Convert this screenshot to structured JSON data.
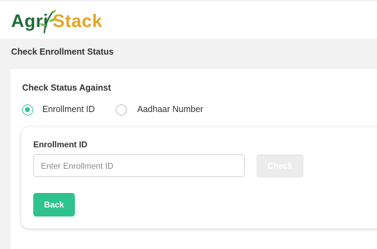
{
  "header": {
    "logo_left": "Agri",
    "logo_right": "Stack"
  },
  "page_title": "Check Enrollment Status",
  "form": {
    "section_label": "Check Status Against",
    "options": [
      {
        "label": "Enrollment ID",
        "selected": true
      },
      {
        "label": "Aadhaar Number",
        "selected": false
      }
    ],
    "field_label": "Enrollment ID",
    "input_value": "",
    "input_placeholder": "Enter Enrollment ID",
    "check_label": "Check",
    "back_label": "Back"
  },
  "colors": {
    "accent": "#2ec28d",
    "logo_green": "#1f6b3a",
    "logo_yellow": "#e2a526",
    "disabled_button": "#ececec"
  }
}
